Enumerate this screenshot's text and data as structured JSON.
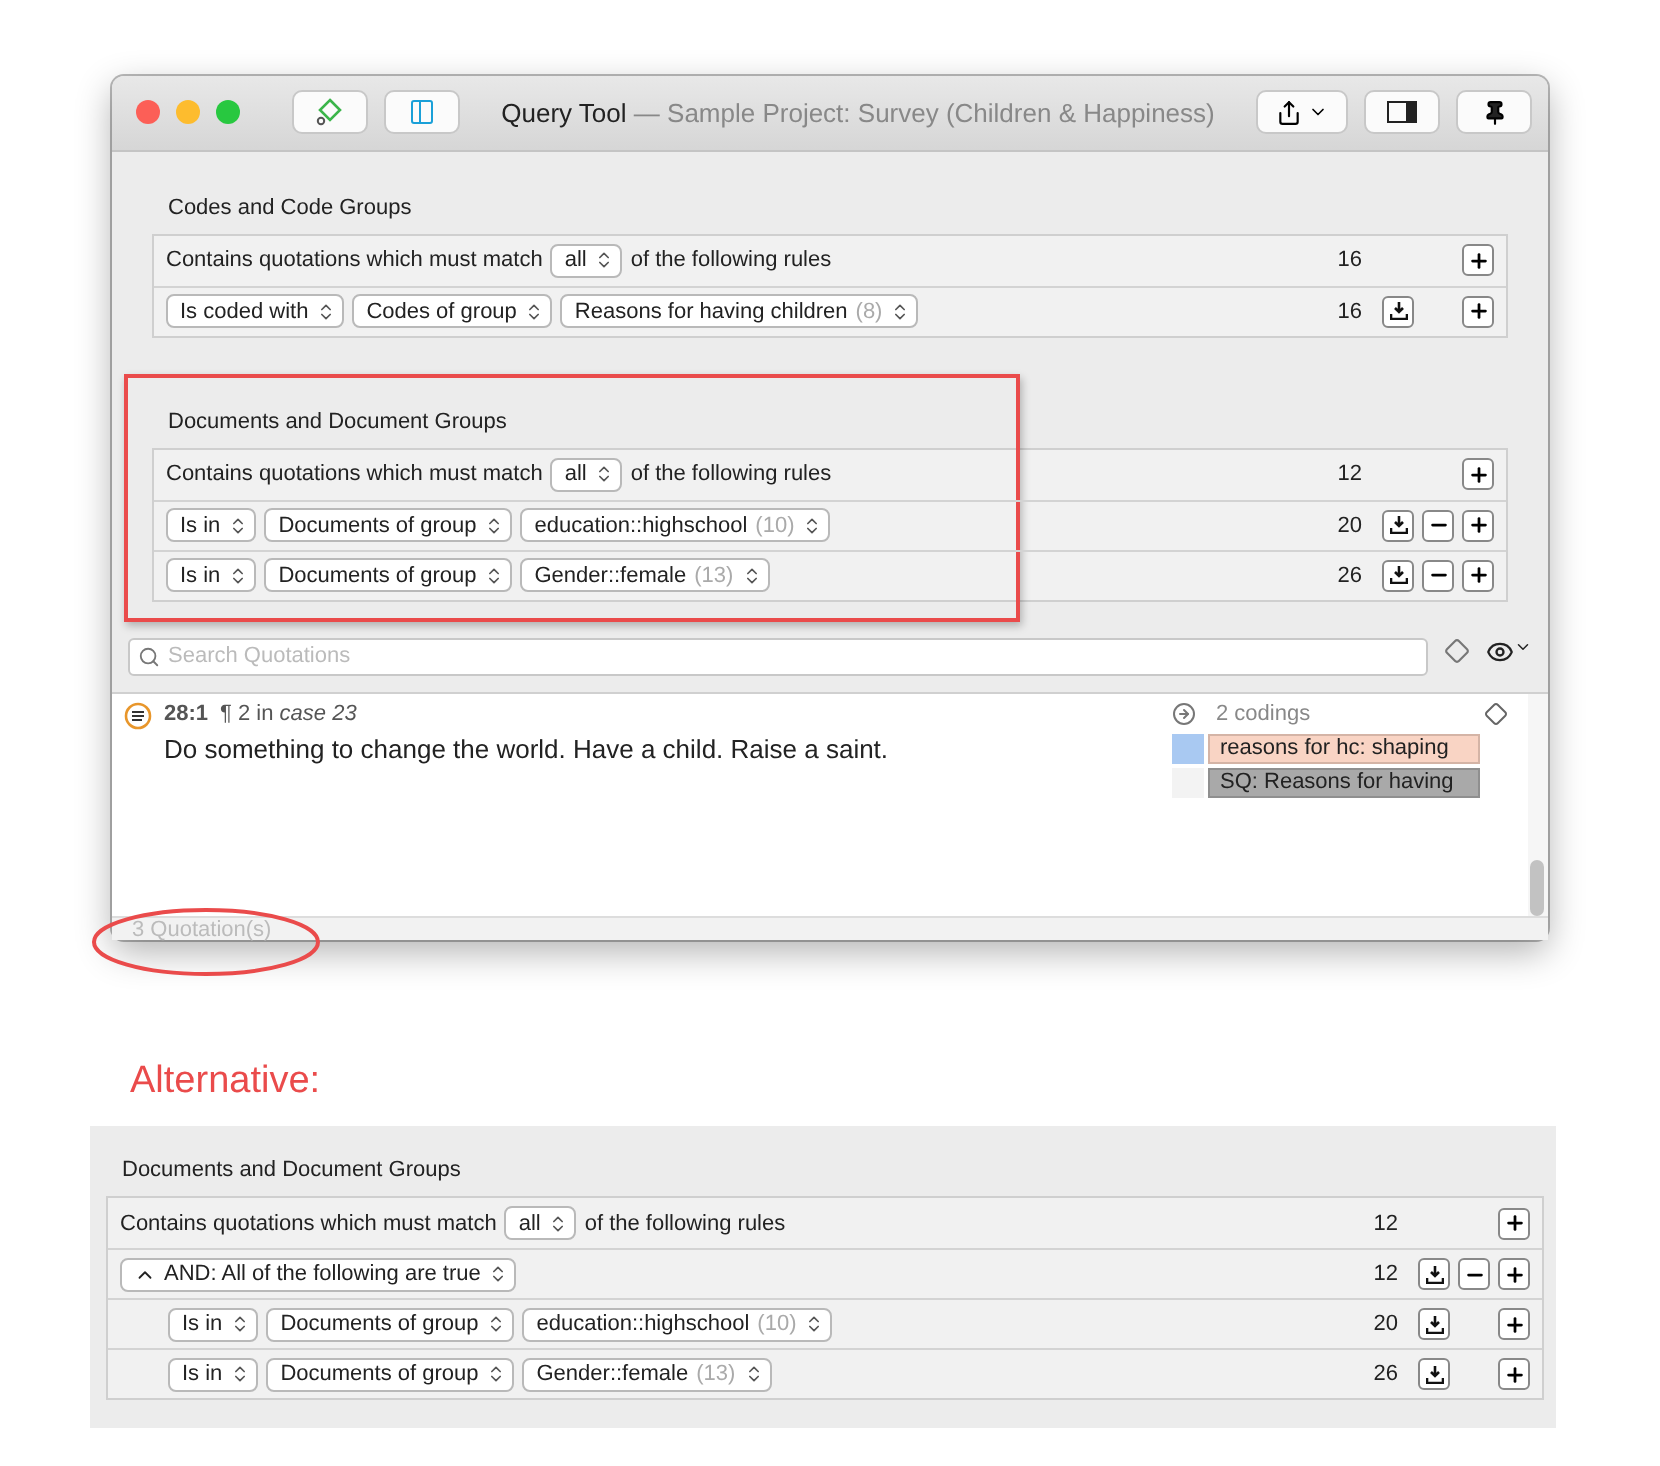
{
  "window": {
    "title": "Query Tool",
    "subtitle": "— Sample Project: Survey (Children & Happiness)"
  },
  "sections": [
    {
      "title": "Codes and Code Groups",
      "highlighted": false,
      "rules": [
        {
          "kind": "header",
          "before": "Contains quotations which must match",
          "select": {
            "label": "all"
          },
          "after": "of the following rules",
          "count": "16",
          "buttons": {
            "export": false,
            "remove": false,
            "add": true
          }
        },
        {
          "kind": "condition",
          "selects": [
            {
              "label": "Is coded with"
            },
            {
              "label": "Codes of group"
            },
            {
              "label": "Reasons for having children",
              "count": "(8)"
            }
          ],
          "count": "16",
          "buttons": {
            "export": true,
            "remove": false,
            "add": true
          }
        }
      ]
    },
    {
      "title": "Documents and Document Groups",
      "highlighted": true,
      "rules": [
        {
          "kind": "header",
          "before": "Contains quotations which must match",
          "select": {
            "label": "all"
          },
          "after": "of the following rules",
          "count": "12",
          "buttons": {
            "export": false,
            "remove": false,
            "add": true
          }
        },
        {
          "kind": "condition",
          "selects": [
            {
              "label": "Is in"
            },
            {
              "label": "Documents of group"
            },
            {
              "label": "education::highschool",
              "count": "(10)"
            }
          ],
          "count": "20",
          "buttons": {
            "export": true,
            "remove": true,
            "add": true
          }
        },
        {
          "kind": "condition",
          "selects": [
            {
              "label": "Is in"
            },
            {
              "label": "Documents of group"
            },
            {
              "label": "Gender::female",
              "count": "(13)"
            }
          ],
          "count": "26",
          "buttons": {
            "export": true,
            "remove": true,
            "add": true
          }
        }
      ]
    }
  ],
  "search": {
    "placeholder": "Search Quotations"
  },
  "quotations": [
    {
      "id": "28:1",
      "location": "¶ 2 in *case 23*",
      "text": "Do something to change the world. Have a child. Raise a saint.",
      "codings_label": "2 codings",
      "codes": [
        {
          "label": "reasons for hc: shaping",
          "color": "#f9d4c4",
          "swatch": {
            "color": "#a9c9f2"
          }
        },
        {
          "label": "SQ: Reasons for having",
          "color": "#a9a9a9",
          "swatch": {
            "color": "#f3f3f3"
          }
        }
      ]
    }
  ],
  "status": {
    "text": "3 Quotation(s)",
    "circled": true
  },
  "alternative": {
    "heading": "Alternative:",
    "section": {
      "title": "Documents and Document Groups",
      "highlighted": false,
      "rules": [
        {
          "kind": "header",
          "before": "Contains quotations which must match",
          "select": {
            "label": "all"
          },
          "after": "of the following rules",
          "count": "12",
          "buttons": {
            "export": false,
            "remove": false,
            "add": true
          }
        },
        {
          "kind": "group",
          "select": {
            "label": "AND: All of the following are true"
          },
          "expanded": true,
          "count": "12",
          "buttons": {
            "export": true,
            "remove": true,
            "add": true
          },
          "children": [
            {
              "kind": "condition",
              "selects": [
                {
                  "label": "Is in"
                },
                {
                  "label": "Documents of group"
                },
                {
                  "label": "education::highschool",
                  "count": "(10)"
                }
              ],
              "count": "20",
              "buttons": {
                "export": true,
                "remove": false,
                "add": true
              }
            },
            {
              "kind": "condition",
              "selects": [
                {
                  "label": "Is in"
                },
                {
                  "label": "Documents of group"
                },
                {
                  "label": "Gender::female",
                  "count": "(13)"
                }
              ],
              "count": "26",
              "buttons": {
                "export": true,
                "remove": false,
                "add": true
              }
            }
          ]
        }
      ]
    }
  }
}
